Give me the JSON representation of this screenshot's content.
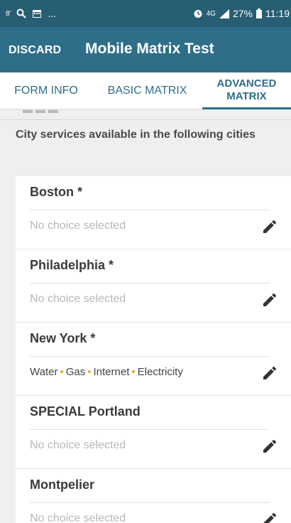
{
  "status_bar": {
    "left_icons": [
      "8'",
      "search-icon",
      "calendar-icon",
      "..."
    ],
    "signal": "4G",
    "battery": "27%",
    "time": "11:19"
  },
  "app_bar": {
    "discard_label": "DISCARD",
    "title": "Mobile Matrix Test"
  },
  "tabs": [
    {
      "label": "FORM INFO"
    },
    {
      "label": "BASIC MATRIX"
    },
    {
      "label": "ADVANCED MATRIX",
      "line1": "ADVANCED",
      "line2": "MATRIX",
      "active": true
    }
  ],
  "section": {
    "title": "City services available in the following cities"
  },
  "items": [
    {
      "label": "Boston *",
      "value": "No choice selected"
    },
    {
      "label": "Philadelphia *",
      "value": "No choice selected"
    },
    {
      "label": "New York *",
      "value_parts": [
        "Water",
        "Gas",
        "Internet",
        "Electricity"
      ]
    },
    {
      "label": "SPECIAL Portland",
      "value": "No choice selected"
    },
    {
      "label": "Montpelier",
      "value": "No choice selected"
    }
  ],
  "colors": {
    "appbar": "#2f6e89",
    "statusbar": "#285e74",
    "accent_dot": "#f0a020"
  }
}
